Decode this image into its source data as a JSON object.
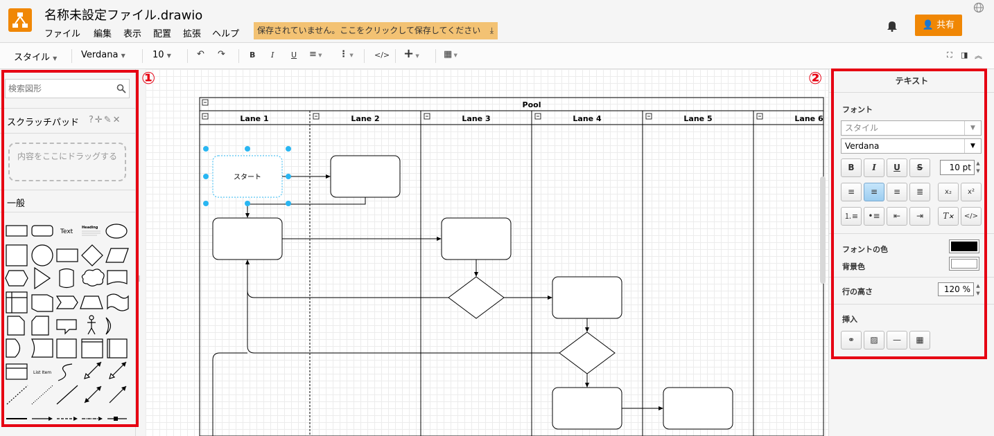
{
  "app": {
    "title": "名称未設定ファイル.drawio",
    "menus": [
      "ファイル",
      "編集",
      "表示",
      "配置",
      "拡張",
      "ヘルプ"
    ],
    "save_banner": "保存されていません。ここをクリックして保存してください",
    "share_label": "共有"
  },
  "toolbar": {
    "style_label": "スタイル",
    "font_label": "Verdana",
    "size_label": "10"
  },
  "sidebar": {
    "search_placeholder": "検索図形",
    "scratchpad_title": "スクラッチパッド",
    "scratchpad_tools": "?✛✎✕",
    "dropzone_text": "内容をここにドラッグする",
    "general_title": "一般",
    "shape_text": "Text",
    "shape_heading": "Heading",
    "shape_listitem": "List Item"
  },
  "diagram": {
    "pool_label": "Pool",
    "lanes": [
      "Lane 1",
      "Lane 2",
      "Lane 3",
      "Lane 4",
      "Lane 5",
      "Lane 6"
    ],
    "start_label": "スタート"
  },
  "format": {
    "title": "テキスト",
    "font_section": "フォント",
    "style_select": "スタイル",
    "font_select": "Verdana",
    "font_size": "10 pt",
    "font_color_label": "フォントの色",
    "bg_color_label": "背景色",
    "line_height_label": "行の高さ",
    "line_height_value": "120 %",
    "insert_label": "挿入",
    "font_color": "#000000",
    "bg_color": "#ffffff"
  },
  "annotations": {
    "marker1": "①",
    "marker2": "②",
    "color": "#e60012"
  }
}
